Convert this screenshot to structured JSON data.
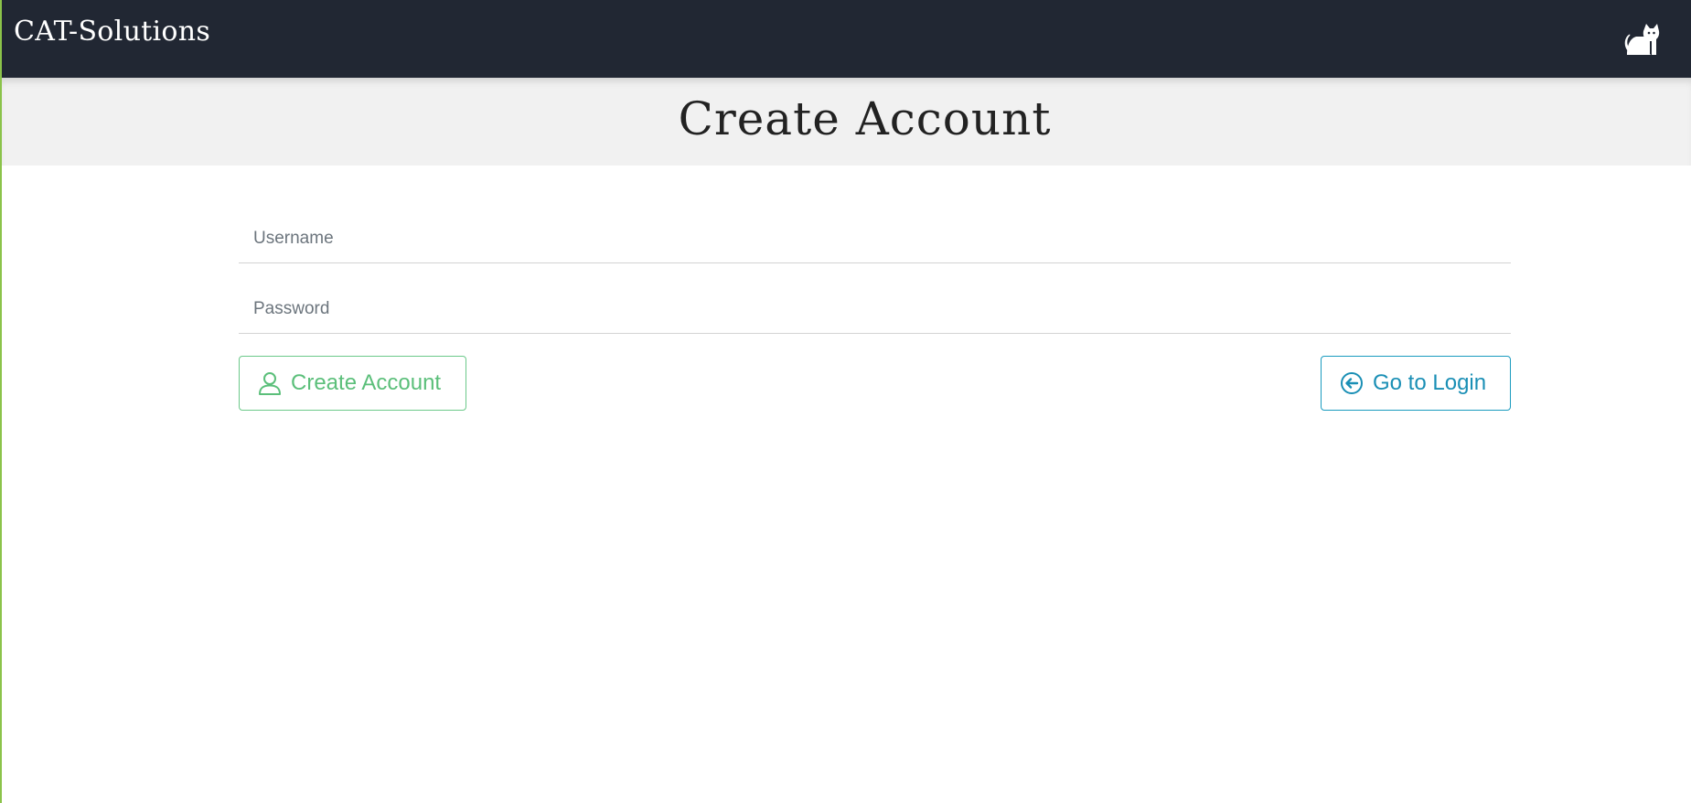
{
  "navbar": {
    "brand": "CAT-Solutions",
    "brand_icon": "cat-icon"
  },
  "header": {
    "title": "Create Account"
  },
  "form": {
    "username": {
      "placeholder": "Username",
      "value": ""
    },
    "password": {
      "placeholder": "Password",
      "value": ""
    }
  },
  "actions": {
    "create_label": "Create Account",
    "create_icon": "user-icon",
    "login_label": "Go to Login",
    "login_icon": "arrow-circle-left-icon"
  },
  "colors": {
    "navbar_bg": "#212733",
    "title_band_bg": "#f1f1f1",
    "success": "#5bbf7a",
    "info": "#1a8fb5",
    "page_border": "#8bc34a"
  }
}
